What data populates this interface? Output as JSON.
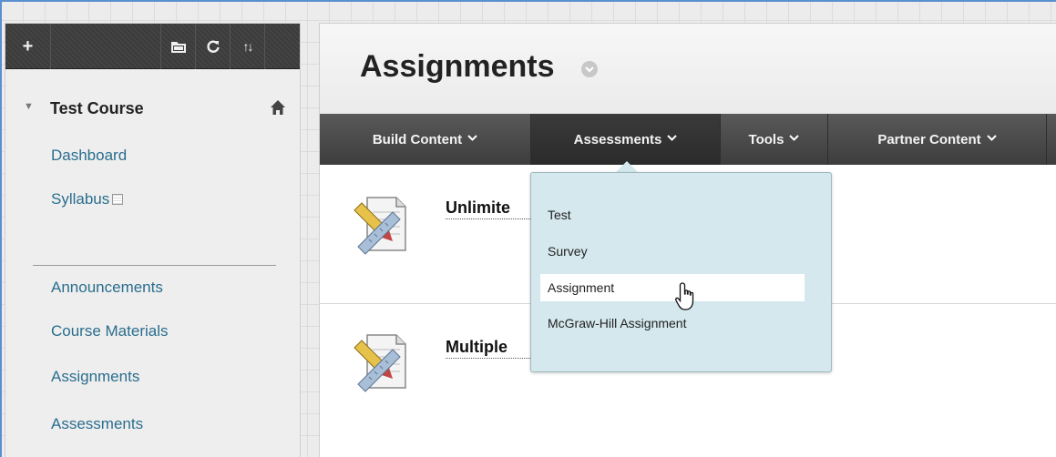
{
  "sidebar": {
    "toolbar": {
      "plus": "+",
      "folder_icon": "folder-icon",
      "refresh_icon": "refresh-icon",
      "sort": "↑↓"
    },
    "course_title": "Test Course",
    "home_icon": "home-icon",
    "items": [
      {
        "label": "Dashboard"
      },
      {
        "label": "Syllabus"
      },
      {
        "label": "Announcements"
      },
      {
        "label": "Course Materials"
      },
      {
        "label": "Assignments"
      },
      {
        "label": "Assessments"
      }
    ]
  },
  "page": {
    "title": "Assignments"
  },
  "action_bar": {
    "items": [
      {
        "label": "Build Content"
      },
      {
        "label": "Assessments"
      },
      {
        "label": "Tools"
      },
      {
        "label": "Partner Content"
      }
    ]
  },
  "content": {
    "items": [
      {
        "title": "Unlimite"
      },
      {
        "title": "Multiple"
      }
    ]
  },
  "dropdown": {
    "items": [
      {
        "label": "Test"
      },
      {
        "label": "Survey"
      },
      {
        "label": "Assignment"
      },
      {
        "label": "McGraw-Hill Assignment"
      }
    ],
    "selected_index": 2
  },
  "colors": {
    "link": "#2a6e8e",
    "toolbar": "#3f3f3f",
    "action_bar": "#4a4a4a",
    "dropdown_bg": "#d4e8ee",
    "frame_border": "#5a8fd0"
  }
}
